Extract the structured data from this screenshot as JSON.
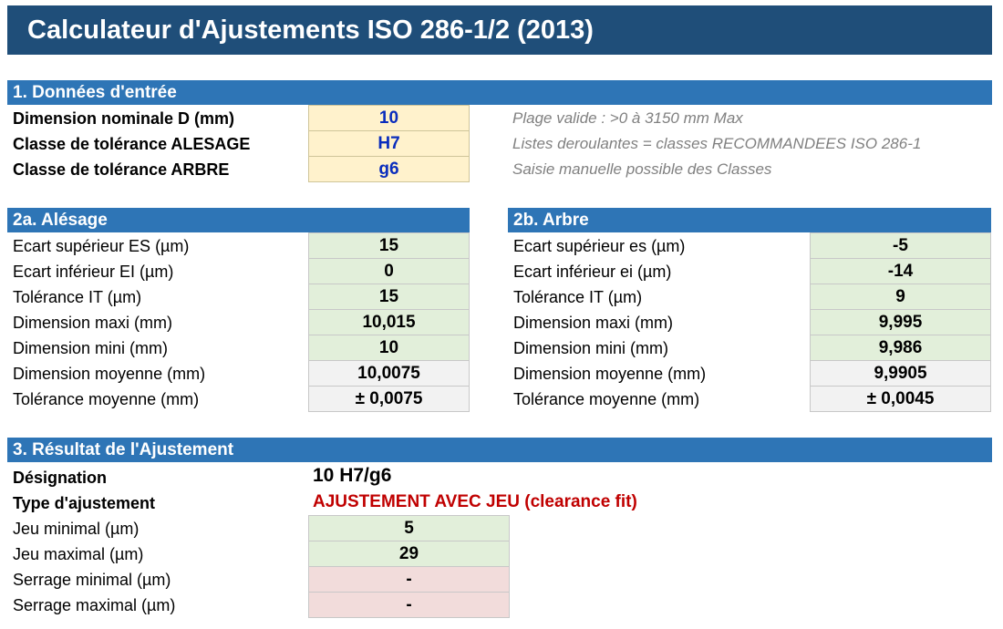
{
  "title": "Calculateur d'Ajustements ISO 286-1/2 (2013)",
  "inputs": {
    "header": "1. Données d'entrée",
    "rows": [
      {
        "label": "Dimension nominale D (mm)",
        "value": "10",
        "note": "Plage valide : >0 à 3150 mm Max"
      },
      {
        "label": "Classe de tolérance ALESAGE",
        "value": "H7",
        "note": "Listes deroulantes = classes RECOMMANDEES ISO 286-1"
      },
      {
        "label": "Classe de tolérance ARBRE",
        "value": "g6",
        "note": "Saisie manuelle possible des Classes"
      }
    ]
  },
  "alesage": {
    "header": "2a. Alésage",
    "rows": [
      {
        "label": "Ecart supérieur ES (µm)",
        "value": "15"
      },
      {
        "label": "Ecart inférieur EI (µm)",
        "value": "0"
      },
      {
        "label": "Tolérance IT (µm)",
        "value": "15"
      },
      {
        "label": "Dimension maxi (mm)",
        "value": "10,015"
      },
      {
        "label": "Dimension mini (mm)",
        "value": "10"
      },
      {
        "label": "Dimension moyenne (mm)",
        "value": "10,0075"
      },
      {
        "label": "Tolérance moyenne (mm)",
        "value": "± 0,0075"
      }
    ]
  },
  "arbre": {
    "header": "2b. Arbre",
    "rows": [
      {
        "label": "Ecart supérieur es (µm)",
        "value": "-5"
      },
      {
        "label": "Ecart inférieur ei (µm)",
        "value": "-14"
      },
      {
        "label": "Tolérance IT (µm)",
        "value": "9"
      },
      {
        "label": "Dimension maxi (mm)",
        "value": "9,995"
      },
      {
        "label": "Dimension mini (mm)",
        "value": "9,986"
      },
      {
        "label": "Dimension moyenne (mm)",
        "value": "9,9905"
      },
      {
        "label": "Tolérance moyenne (mm)",
        "value": "± 0,0045"
      }
    ]
  },
  "result": {
    "header": "3. Résultat de l'Ajustement",
    "designation_label": "Désignation",
    "designation_value": "10 H7/g6",
    "type_label": "Type d'ajustement",
    "type_value": "AJUSTEMENT AVEC JEU (clearance fit)",
    "rows": [
      {
        "label": "Jeu minimal (µm)",
        "value": "5"
      },
      {
        "label": "Jeu maximal (µm)",
        "value": "29"
      },
      {
        "label": "Serrage minimal (µm)",
        "value": "-"
      },
      {
        "label": "Serrage maximal (µm)",
        "value": "-"
      }
    ]
  },
  "colors": {
    "title_bg": "#1f4e79",
    "header_bg": "#2e75b6",
    "input_bg": "#fff2cc",
    "input_text": "#0a2dbd",
    "computed_bg": "#e2efda",
    "average_bg": "#f2f2f2",
    "interference_bg": "#f2dcdb",
    "fit_type_text": "#c00000"
  }
}
